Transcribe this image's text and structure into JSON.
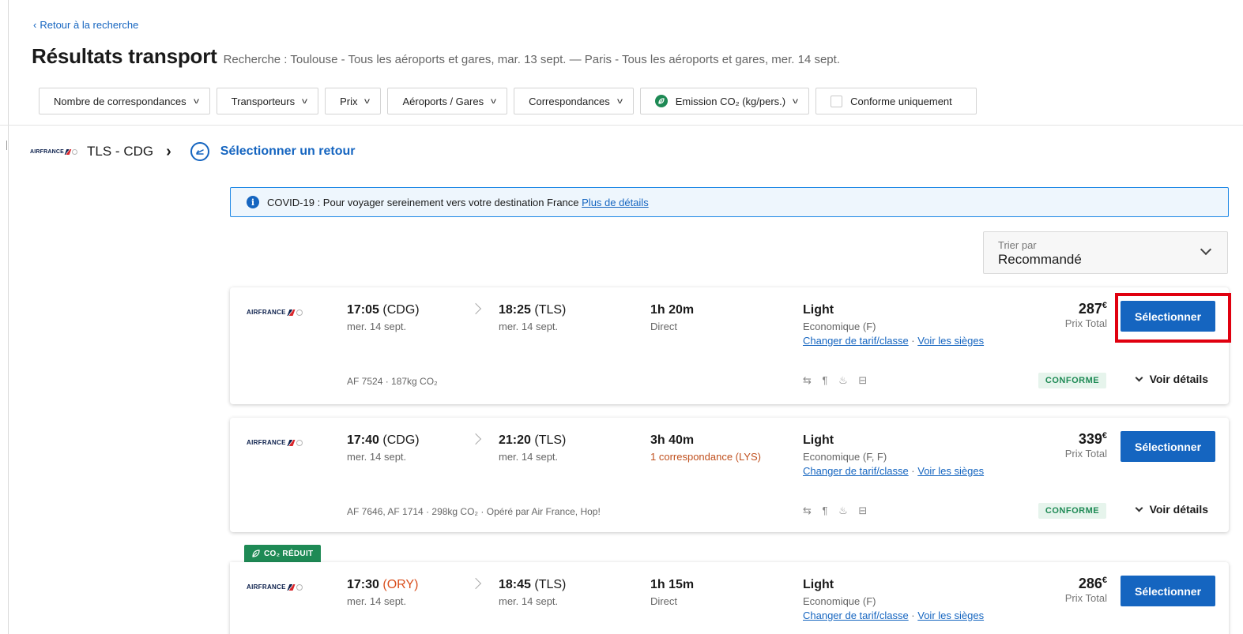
{
  "nav": {
    "back_label": "Retour à la recherche"
  },
  "header": {
    "title": "Résultats transport",
    "summary": "Recherche : Toulouse - Tous les aéroports et gares, mar. 13 sept. — Paris - Tous les aéroports et gares, mer. 14 sept."
  },
  "filters": [
    {
      "label": "Nombre de correspondances"
    },
    {
      "label": "Transporteurs"
    },
    {
      "label": "Prix"
    },
    {
      "label": "Aéroports / Gares"
    },
    {
      "label": "Correspondances"
    },
    {
      "label": "Emission CO₂ (kg/pers.)"
    },
    {
      "label": "Conforme uniquement"
    }
  ],
  "route": {
    "airline_logo_text": "AIRFRANCE",
    "code": "TLS - CDG",
    "return_label": "Sélectionner un retour"
  },
  "banner": {
    "text": "COVID-19 : Pour voyager sereinement vers votre destination France",
    "link": "Plus de détails"
  },
  "sort": {
    "label": "Trier par",
    "value": "Recommandé"
  },
  "flights": [
    {
      "airline": "AIRFRANCE",
      "dep_time": "17:05",
      "dep_code": "(CDG)",
      "dep_date": "mer. 14 sept.",
      "arr_time": "18:25",
      "arr_code": "(TLS)",
      "arr_date": "mer. 14 sept.",
      "duration": "1h 20m",
      "stops": "Direct",
      "fare": "Light",
      "cabin": "Economique (F)",
      "change_link": "Changer de tarif/classe",
      "separator": " · ",
      "seats_link": "Voir les sièges",
      "price": "287",
      "currency": "€",
      "price_label": "Prix Total",
      "select_label": "Sélectionner",
      "info": "AF 7524 · 187kg CO₂",
      "amenities": "⇆ ¶ ♨ ⊟",
      "badge": "CONFORME",
      "details_label": "Voir détails"
    },
    {
      "airline": "AIRFRANCE",
      "dep_time": "17:40",
      "dep_code": "(CDG)",
      "dep_date": "mer. 14 sept.",
      "arr_time": "21:20",
      "arr_code": "(TLS)",
      "arr_date": "mer. 14 sept.",
      "duration": "3h 40m",
      "stops": "1 correspondance (LYS)",
      "fare": "Light",
      "cabin": "Economique (F, F)",
      "change_link": "Changer de tarif/classe",
      "separator": " · ",
      "seats_link": "Voir les sièges",
      "price": "339",
      "currency": "€",
      "price_label": "Prix Total",
      "select_label": "Sélectionner",
      "info": "AF 7646, AF 1714 · 298kg CO₂ · Opéré par Air France, Hop!",
      "amenities": "⇆ ¶ ♨ ⊟",
      "badge": "CONFORME",
      "details_label": "Voir détails"
    },
    {
      "airline": "AIRFRANCE",
      "tag": "CO₂ RÉDUIT",
      "dep_time": "17:30",
      "dep_code": "(ORY)",
      "dep_date": "mer. 14 sept.",
      "arr_time": "18:45",
      "arr_code": "(TLS)",
      "arr_date": "mer. 14 sept.",
      "duration": "1h 15m",
      "stops": "Direct",
      "fare": "Light",
      "cabin": "Economique (F)",
      "change_link": "Changer de tarif/classe",
      "separator": " · ",
      "seats_link": "Voir les sièges",
      "price": "286",
      "currency": "€",
      "price_label": "Prix Total",
      "select_label": "Sélectionner"
    }
  ],
  "colors": {
    "accent": "#1565c0",
    "highlight": "#e0000f",
    "eco_green": "#1e8a55",
    "warning": "#d94f1e"
  }
}
